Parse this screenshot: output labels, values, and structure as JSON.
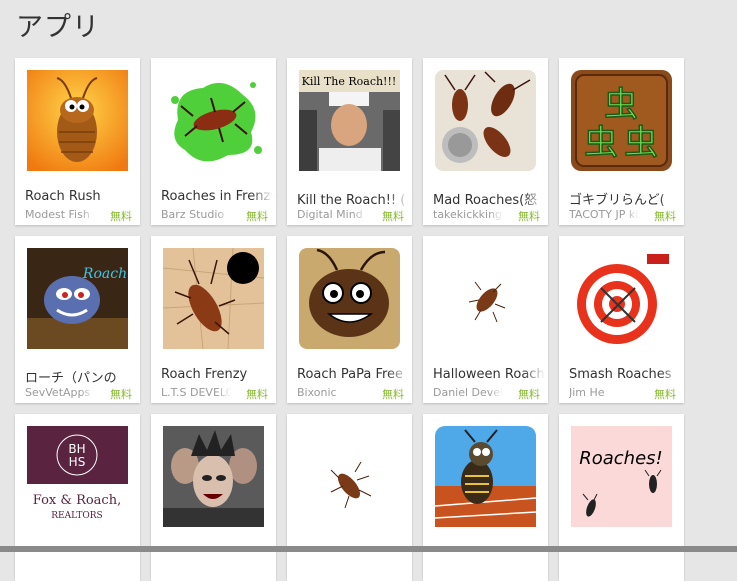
{
  "header": {
    "title": "アプリ"
  },
  "apps": [
    {
      "title": "Roach Rush",
      "developer": "Modest Fish",
      "price": "無料",
      "icon": "roach-rush-icon"
    },
    {
      "title": "Roaches in Frenzy",
      "developer": "Barz Studio",
      "price": "無料",
      "icon": "roaches-in-frenzy-icon"
    },
    {
      "title": "Kill the Roach!! (ゴキブリ",
      "developer": "Digital Mind",
      "price": "無料",
      "icon": "kill-the-roach-icon"
    },
    {
      "title": "Mad Roaches(怒",
      "developer": "takekickking",
      "price": "無料",
      "icon": "mad-roaches-icon"
    },
    {
      "title": "ゴキブリらんど(",
      "developer": "TACOTY JP kin",
      "price": "無料",
      "icon": "mushi-kanji-icon"
    },
    {
      "title": "ローチ（パンの",
      "developer": "SevVetApps",
      "price": "無料",
      "icon": "roach-cartoon-icon"
    },
    {
      "title": "Roach Frenzy",
      "developer": "L.T.S DEVELOPER",
      "price": "無料",
      "icon": "roach-frenzy-icon"
    },
    {
      "title": "Roach PaPa Free",
      "developer": "Bixonic",
      "price": "無料",
      "icon": "roach-papa-icon"
    },
    {
      "title": "Halloween Roach",
      "developer": "Daniel Developer",
      "price": "無料",
      "icon": "halloween-roach-icon"
    },
    {
      "title": "Smash Roaches",
      "developer": "Jim He",
      "price": "無料",
      "icon": "smash-roaches-icon"
    },
    {
      "title": "",
      "developer": "",
      "price": "",
      "icon": "bhhs-logo-icon",
      "logo_text": [
        "BH",
        "HS",
        "Fox & Roach,",
        "REALTORS"
      ]
    },
    {
      "title": "",
      "developer": "",
      "price": "",
      "icon": "band-photo-icon"
    },
    {
      "title": "",
      "developer": "",
      "price": "",
      "icon": "cockroach-icon"
    },
    {
      "title": "",
      "developer": "",
      "price": "",
      "icon": "cartoon-bug-icon"
    },
    {
      "title": "",
      "developer": "",
      "price": "",
      "icon": "roaches-text-icon",
      "logo_text": [
        "Roaches!"
      ]
    }
  ],
  "colors": {
    "price": "#8bbc34",
    "background": "#e6e6e6",
    "card": "#ffffff"
  }
}
